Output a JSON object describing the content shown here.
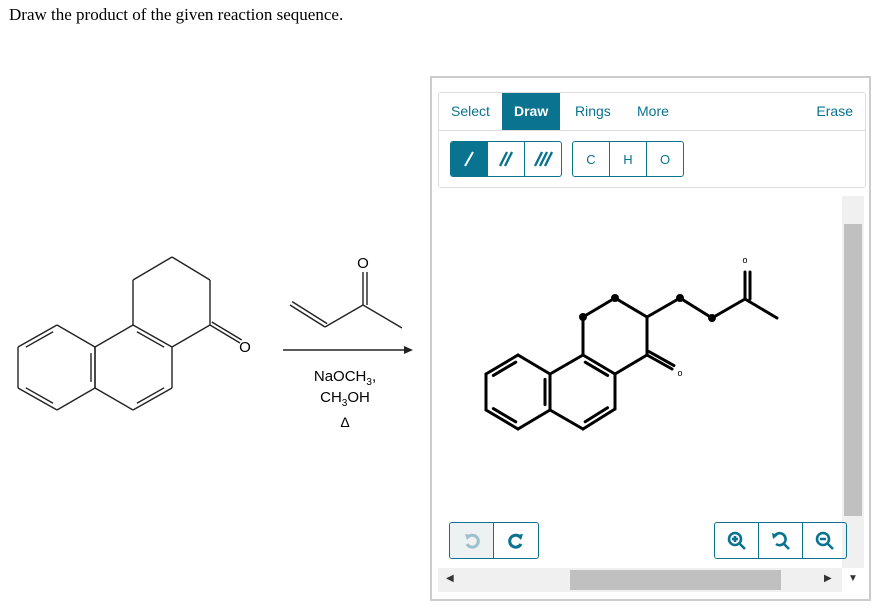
{
  "question": "Draw the product of the given reaction sequence.",
  "reaction": {
    "reagent1": "NaOCH",
    "reagent1_sub": "3",
    "reagent1_tail": ",",
    "reagent2_a": "CH",
    "reagent2_sub": "3",
    "reagent2_b": "OH",
    "heat": "Δ",
    "oxygen": "O"
  },
  "editor": {
    "tabs": [
      {
        "label": "Select"
      },
      {
        "label": "Draw",
        "active": true
      },
      {
        "label": "Rings"
      },
      {
        "label": "More"
      }
    ],
    "erase": "Erase",
    "atoms": [
      "C",
      "H",
      "O"
    ],
    "canvas_atom_label": "o",
    "icons": [
      "single-bond-icon",
      "double-bond-icon",
      "triple-bond-icon",
      "undo-icon",
      "redo-icon",
      "zoom-in-icon",
      "zoom-reset-icon",
      "zoom-out-icon"
    ],
    "accent": "#0a7390"
  }
}
